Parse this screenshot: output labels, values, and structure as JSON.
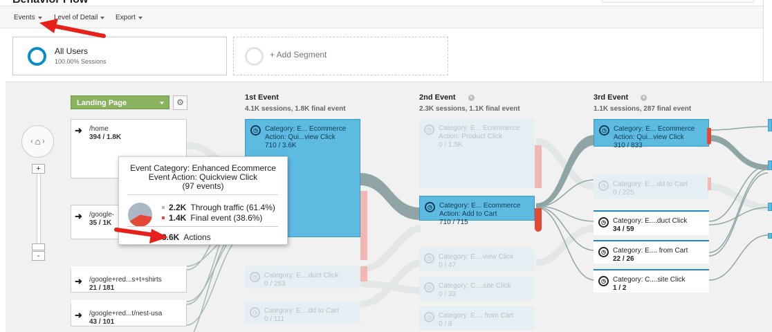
{
  "header": {
    "title": "Behavior Flow",
    "toolbar": [
      {
        "label": "Events"
      },
      {
        "label": "Level of Detail"
      },
      {
        "label": "Export"
      }
    ]
  },
  "segments": {
    "active": {
      "name": "All Users",
      "sessions": "100.00% Sessions"
    },
    "add_label": "+ Add Segment"
  },
  "controls": {
    "dimension_selector": "Landing Page",
    "zoom_in": "+",
    "zoom_out": "-"
  },
  "columns": [
    {
      "name": "1st Event",
      "summary": "4.1K sessions, 1.8K final event"
    },
    {
      "name": "2nd Event",
      "summary": "2.3K sessions, 1.1K final event"
    },
    {
      "name": "3rd Event",
      "summary": "1.1K sessions, 287 final event"
    }
  ],
  "landing_pages": [
    {
      "name": "/home",
      "value": "394 / 1.8K"
    },
    {
      "name": "/google-",
      "value": "35 / 1K"
    },
    {
      "name": "/google+red...s+t+shirts",
      "value": "21 / 181"
    },
    {
      "name": "/google+red...t/nest-usa",
      "value": "43 / 101"
    }
  ],
  "event1_nodes": [
    {
      "line1": "Category: E... Ecommerce",
      "line2": "Action: Qui...view Click",
      "value": "710 / 3.6K"
    },
    {
      "line1": "Category: E....duct Click",
      "line2": "",
      "value": "0 / 253"
    },
    {
      "line1": "Category: E....dd to Cart",
      "line2": "",
      "value": "0 / 111"
    }
  ],
  "event2_nodes": [
    {
      "line1": "Category: E... Ecommerce",
      "line2": "Action: Product Click",
      "value": "0 / 1.5K"
    },
    {
      "line1": "Category: E... Ecommerce",
      "line2": "Action: Add to Cart",
      "value": "710 / 715"
    },
    {
      "line1": "Category: E....view Click",
      "line2": "",
      "value": "0 / 47"
    },
    {
      "line1": "Category: C....site Click",
      "line2": "",
      "value": "0 / 33"
    },
    {
      "line1": "Category: E.... from Cart",
      "line2": "",
      "value": "0 / 8"
    }
  ],
  "event3_nodes": [
    {
      "line1": "Category: E... Ecommerce",
      "line2": "Action: Qui...view Click",
      "value": "310 / 833"
    },
    {
      "line1": "Category: E....dd to Cart",
      "line2": "",
      "value": "0 / 225"
    },
    {
      "line1": "Category: E....duct Click",
      "line2": "",
      "value": "34 / 59"
    },
    {
      "line1": "Category: E.... from Cart",
      "line2": "",
      "value": "22 / 26"
    },
    {
      "line1": "Category: C....site Click",
      "line2": "",
      "value": "1 / 2"
    }
  ],
  "tooltip": {
    "line1": "Event Category: Enhanced Ecommerce",
    "line2": "Event Action: Quickview Click",
    "line3": "(97 events)",
    "through_value": "2.2K",
    "through_label": "Through traffic (61.4%)",
    "final_value": "1.4K",
    "final_label": "Final event (38.6%)",
    "actions_value": "3.6K",
    "actions_label": "Actions",
    "through_fraction": 0.614,
    "final_fraction": 0.386
  },
  "colors": {
    "node_blue": "#5dbbe2",
    "flow_gray": "#8fa5a5",
    "dropoff_red": "#e34a36",
    "dimension_green": "#8ab360",
    "annotation_red": "#e8201a"
  }
}
